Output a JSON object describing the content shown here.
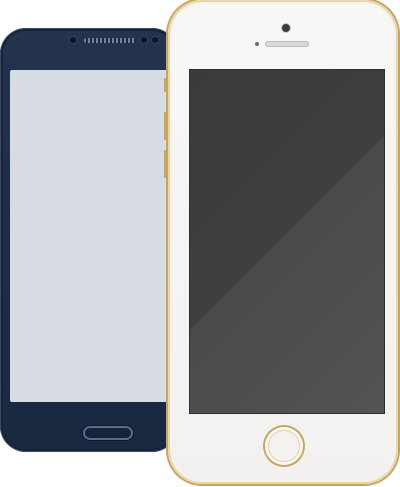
{
  "devices": {
    "android": {
      "color": "#1e2c45",
      "screen_color": "#d6dce2"
    },
    "iphone": {
      "color": "#f4f2ee",
      "accent": "#c9a55a",
      "screen_color": "#3f3f3f"
    }
  }
}
